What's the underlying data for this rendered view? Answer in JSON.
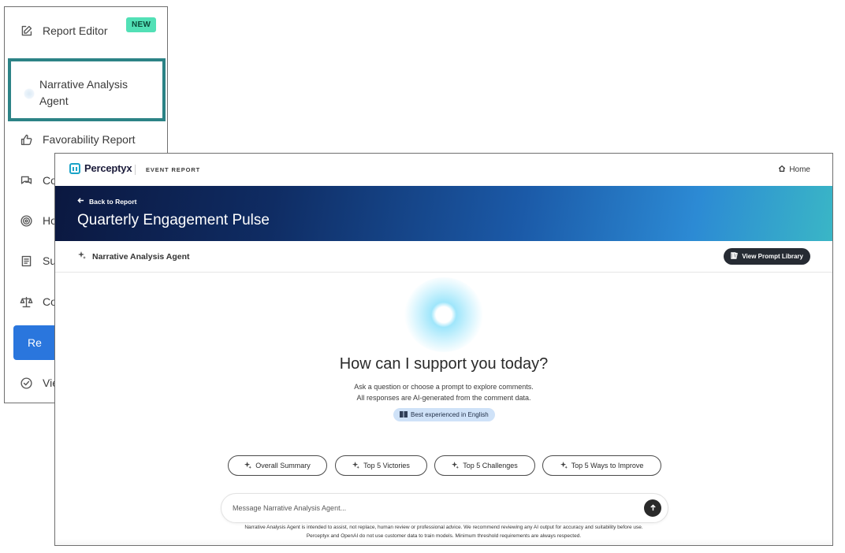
{
  "sidebar": {
    "items": [
      {
        "label": "Report Editor",
        "icon": "edit-icon",
        "badge": "NEW"
      },
      {
        "label": "Narrative Analysis Agent",
        "icon": "loading-spinner-icon",
        "highlighted": true
      },
      {
        "label": "Favorability Report",
        "icon": "thumbs-up-icon"
      },
      {
        "label": "Co",
        "icon": "comments-icon"
      },
      {
        "label": "Ho",
        "icon": "target-icon"
      },
      {
        "label": "Su",
        "icon": "document-icon"
      },
      {
        "label": "Co",
        "icon": "scale-icon"
      },
      {
        "label": "Re",
        "icon": "bar-chart-icon",
        "active": true
      },
      {
        "label": "Vie",
        "icon": "check-circle-icon"
      }
    ],
    "highlight_color": "#2c8386",
    "active_color": "#2a76dd",
    "badge_color": "#52e0b6"
  },
  "header": {
    "logo_text": "Perceptyx",
    "section_label": "EVENT REPORT",
    "home_label": "Home"
  },
  "banner": {
    "back_label": "Back to Report",
    "title": "Quarterly Engagement Pulse"
  },
  "agent_bar": {
    "name": "Narrative Analysis Agent",
    "prompt_library_label": "View Prompt Library"
  },
  "main": {
    "headline": "How can I support you today?",
    "subtext_line1": "Ask a question or choose a prompt to explore comments.",
    "subtext_line2": "All responses are AI-generated from the comment data.",
    "language_badge": "Best experienced in English",
    "prompt_chips": [
      "Overall Summary",
      "Top 5 Victories",
      "Top 5 Challenges",
      "Top 5 Ways to Improve"
    ],
    "composer_placeholder": "Message Narrative Analysis Agent...",
    "disclaimer_line1": "Narrative Analysis Agent is intended to assist, not replace, human review or professional advice. We recommend reviewing any AI output for accuracy and suitability before use.",
    "disclaimer_line2": "Perceptyx and OpenAI do not use customer data to train models. Minimum threshold requirements are always respected."
  }
}
